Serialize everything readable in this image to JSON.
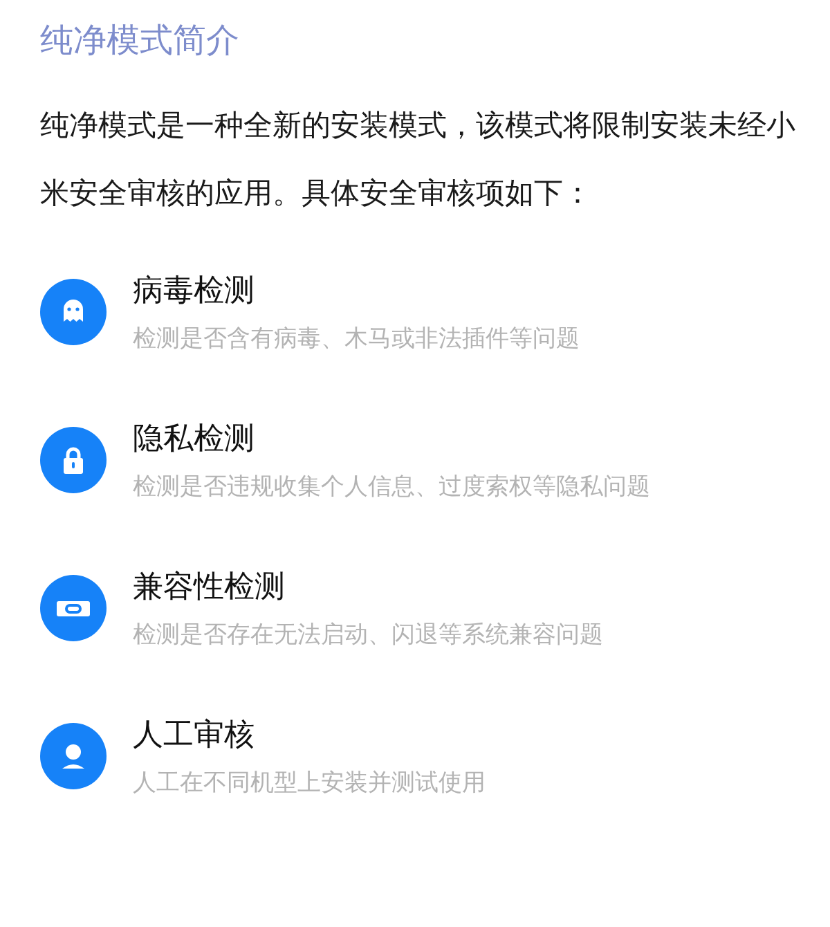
{
  "title": "纯净模式简介",
  "intro": "纯净模式是一种全新的安装模式，该模式将限制安装未经小米安全审核的应用。具体安全审核项如下：",
  "items": [
    {
      "kind": "ghost",
      "title": "病毒检测",
      "description": "检测是否含有病毒、木马或非法插件等问题"
    },
    {
      "kind": "lock",
      "title": "隐私检测",
      "description": "检测是否违规收集个人信息、过度索权等隐私问题"
    },
    {
      "kind": "link",
      "title": "兼容性检测",
      "description": "检测是否存在无法启动、闪退等系统兼容问题"
    },
    {
      "kind": "person",
      "title": "人工审核",
      "description": "人工在不同机型上安装并测试使用"
    }
  ]
}
